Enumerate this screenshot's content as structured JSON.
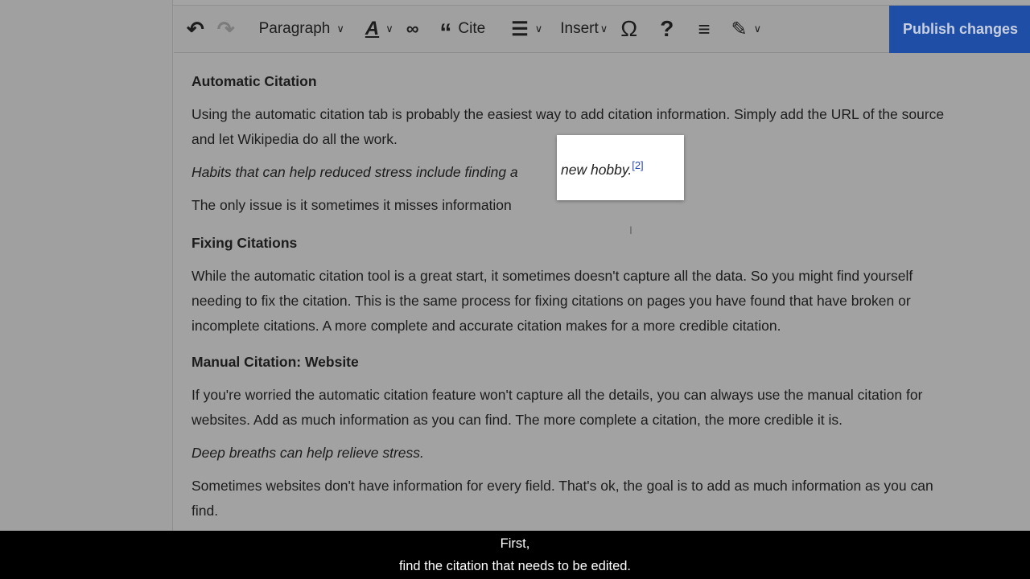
{
  "toolbar": {
    "undo": "undo-icon",
    "redo": "redo-icon",
    "paragraph": "Paragraph",
    "cite": "Cite",
    "insert": "Insert",
    "publish": "Publish changes"
  },
  "content": {
    "h1": "Automatic Citation",
    "p1a": "Using the automatic citation tab is probably the easiest way to add citation information. Simply add the URL of the source",
    "p1b": "and let Wikipedia do all the work.",
    "p2": "Habits that can help reduced stress include finding a",
    "p3": "The only issue is it sometimes it misses information",
    "h2": "Fixing Citations",
    "p4a": "While the automatic citation tool is a great start, it sometimes doesn't capture all the data. So you might find yourself",
    "p4b": "needing to fix the citation. This is the same process for fixing citations on pages you have found that have broken or",
    "p4c": "incomplete citations. A more complete and accurate citation makes for a more credible citation.",
    "h3": "Manual Citation: Website",
    "p5a": "If you're worried the automatic citation feature won't capture all the details, you can always use the manual citation for",
    "p5b": "websites. Add as much information as you can find. The more complete a citation, the more credible it is.",
    "p6": "Deep breaths can help relieve stress.",
    "p7a": "Sometimes websites don't have information for every field. That's ok, the goal is to add as much information as you can",
    "p7b": "find."
  },
  "popup": {
    "text": "new hobby.",
    "ref": "[2]"
  },
  "subtitles": {
    "line1": "First,",
    "line2": "find the citation that needs to be edited."
  }
}
